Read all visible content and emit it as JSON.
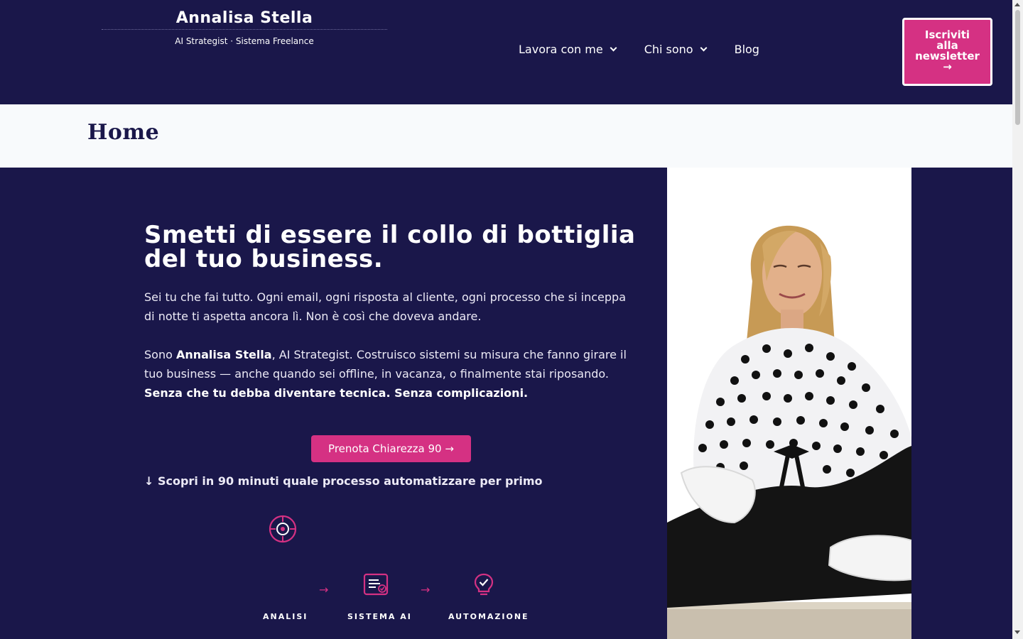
{
  "header": {
    "brand_name": "Annalisa Stella",
    "brand_sub": "AI Strategist · Sistema Freelance",
    "nav": [
      {
        "label": "Lavora con me"
      },
      {
        "label": "Chi sono"
      },
      {
        "label": "Blog"
      }
    ],
    "cta_lines": [
      "Iscriviti",
      "alla",
      "newsletter",
      "→"
    ]
  },
  "titlebar": {
    "title": "Home"
  },
  "hero": {
    "title_line1": "Smetti di essere il collo di bottiglia",
    "title_line2": "del tuo business.",
    "p1": "Sei tu che fai tutto. Ogni email, ogni risposta al cliente, ogni processo che si inceppa di notte ti aspetta ancora lì. Non è così che doveva andare.",
    "p2_prefix": "Sono ",
    "p2_name": "Annalisa Stella",
    "p2_rest": ", AI Strategist. Costruisco sistemi su misura che fanno girare il tuo business — anche quando sei offline, in vacanza, o finalmente stai riposando.",
    "p2_bold": "Senza che tu debba diventare tecnica. Senza complicazioni.",
    "button": "Prenota Chiarezza 90 →",
    "subline": "↓ Scopri in 90 minuti quale processo automatizzare per primo",
    "steps": [
      {
        "label": "ANALISI",
        "icon": "target-icon"
      },
      {
        "label": "SISTEMA AI",
        "icon": "document-check-icon"
      },
      {
        "label": "AUTOMAZIONE",
        "icon": "lightbulb-check-icon"
      }
    ],
    "arrow": "→"
  },
  "colors": {
    "navy": "#1a174a",
    "accent": "#d53183",
    "light": "#f8fafc"
  }
}
